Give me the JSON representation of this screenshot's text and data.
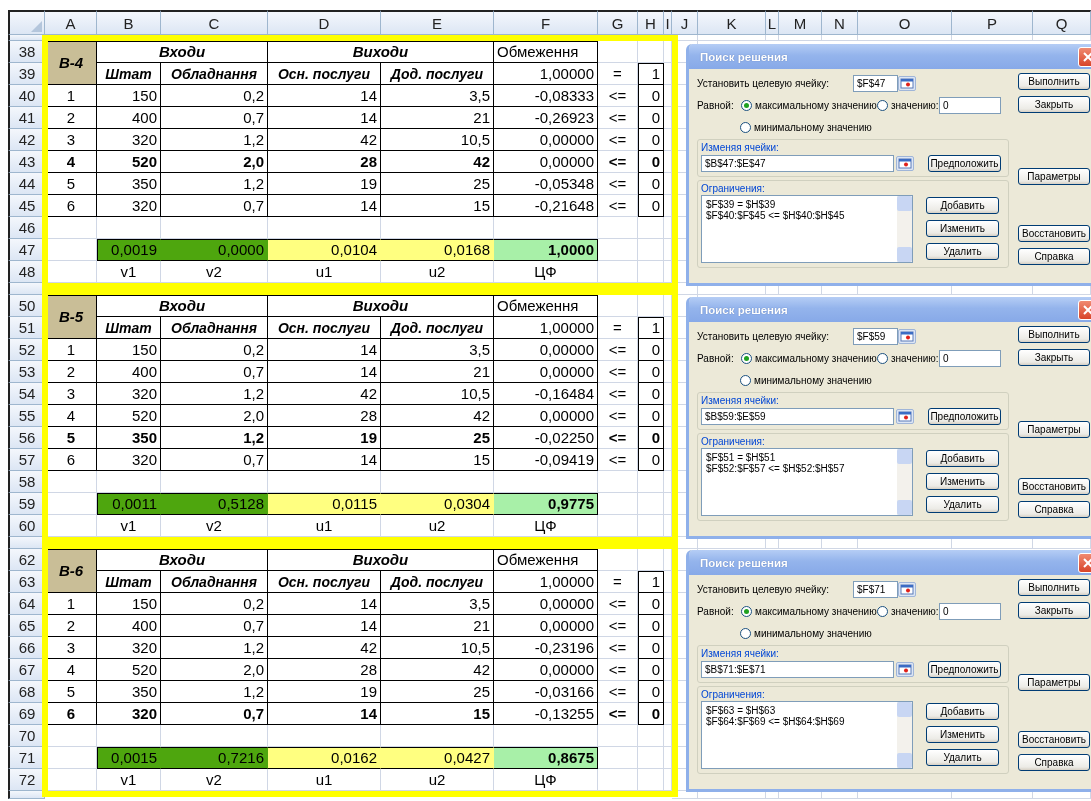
{
  "columns": [
    "A",
    "B",
    "C",
    "D",
    "E",
    "F",
    "G",
    "H",
    "I",
    "J",
    "K",
    "L",
    "M",
    "N",
    "O",
    "P",
    "Q"
  ],
  "blocks": [
    {
      "row_numbers": [
        "38",
        "39",
        "40",
        "41",
        "42",
        "43",
        "44",
        "45",
        "46",
        "47",
        "48"
      ],
      "label": "B-4",
      "groups": [
        "Входи",
        "Виходи"
      ],
      "limit_header": "Обмеження",
      "sub_headers": [
        "Штат",
        "Обладнання",
        "Осн. послуги",
        "Дод. послуги"
      ],
      "norm": {
        "value": "1,00000",
        "op": "=",
        "bound": "1"
      },
      "rows": [
        {
          "index": "1",
          "values": [
            "150",
            "0,2",
            "14",
            "3,5"
          ],
          "constraint": "-0,08333",
          "op": "<=",
          "bound": "0",
          "highlighted": false
        },
        {
          "index": "2",
          "values": [
            "400",
            "0,7",
            "14",
            "21"
          ],
          "constraint": "-0,26923",
          "op": "<=",
          "bound": "0",
          "highlighted": false
        },
        {
          "index": "3",
          "values": [
            "320",
            "1,2",
            "42",
            "10,5"
          ],
          "constraint": "0,00000",
          "op": "<=",
          "bound": "0",
          "highlighted": false
        },
        {
          "index": "4",
          "values": [
            "520",
            "2,0",
            "28",
            "42"
          ],
          "constraint": "0,00000",
          "op": "<=",
          "bound": "0",
          "highlighted": true
        },
        {
          "index": "5",
          "values": [
            "350",
            "1,2",
            "19",
            "25"
          ],
          "constraint": "-0,05348",
          "op": "<=",
          "bound": "0",
          "highlighted": false
        },
        {
          "index": "6",
          "values": [
            "320",
            "0,7",
            "14",
            "15"
          ],
          "constraint": "-0,21648",
          "op": "<=",
          "bound": "0",
          "highlighted": false
        }
      ],
      "weights": [
        {
          "value": "0,0019",
          "label": "v1",
          "color": "#4ea60e"
        },
        {
          "value": "0,0000",
          "label": "v2",
          "color": "#4ea60e"
        },
        {
          "value": "0,0104",
          "label": "u1",
          "color": "#ffff80"
        },
        {
          "value": "0,0168",
          "label": "u2",
          "color": "#ffff80"
        }
      ],
      "objective": {
        "value": "1,0000",
        "label": "ЦФ"
      }
    },
    {
      "row_numbers": [
        "50",
        "51",
        "52",
        "53",
        "54",
        "55",
        "56",
        "57",
        "58",
        "59",
        "60"
      ],
      "label": "B-5",
      "groups": [
        "Входи",
        "Виходи"
      ],
      "limit_header": "Обмеження",
      "sub_headers": [
        "Штат",
        "Обладнання",
        "Осн. послуги",
        "Дод. послуги"
      ],
      "norm": {
        "value": "1,00000",
        "op": "=",
        "bound": "1"
      },
      "rows": [
        {
          "index": "1",
          "values": [
            "150",
            "0,2",
            "14",
            "3,5"
          ],
          "constraint": "0,00000",
          "op": "<=",
          "bound": "0",
          "highlighted": false
        },
        {
          "index": "2",
          "values": [
            "400",
            "0,7",
            "14",
            "21"
          ],
          "constraint": "0,00000",
          "op": "<=",
          "bound": "0",
          "highlighted": false
        },
        {
          "index": "3",
          "values": [
            "320",
            "1,2",
            "42",
            "10,5"
          ],
          "constraint": "-0,16484",
          "op": "<=",
          "bound": "0",
          "highlighted": false
        },
        {
          "index": "4",
          "values": [
            "520",
            "2,0",
            "28",
            "42"
          ],
          "constraint": "0,00000",
          "op": "<=",
          "bound": "0",
          "highlighted": false
        },
        {
          "index": "5",
          "values": [
            "350",
            "1,2",
            "19",
            "25"
          ],
          "constraint": "-0,02250",
          "op": "<=",
          "bound": "0",
          "highlighted": true
        },
        {
          "index": "6",
          "values": [
            "320",
            "0,7",
            "14",
            "15"
          ],
          "constraint": "-0,09419",
          "op": "<=",
          "bound": "0",
          "highlighted": false
        }
      ],
      "weights": [
        {
          "value": "0,0011",
          "label": "v1",
          "color": "#4ea60e"
        },
        {
          "value": "0,5128",
          "label": "v2",
          "color": "#4ea60e"
        },
        {
          "value": "0,0115",
          "label": "u1",
          "color": "#ffff80"
        },
        {
          "value": "0,0304",
          "label": "u2",
          "color": "#ffff80"
        }
      ],
      "objective": {
        "value": "0,9775",
        "label": "ЦФ"
      }
    },
    {
      "row_numbers": [
        "62",
        "63",
        "64",
        "65",
        "66",
        "67",
        "68",
        "69",
        "70",
        "71",
        "72"
      ],
      "label": "B-6",
      "groups": [
        "Входи",
        "Виходи"
      ],
      "limit_header": "Обмеження",
      "sub_headers": [
        "Штат",
        "Обладнання",
        "Осн. послуги",
        "Дод. послуги"
      ],
      "norm": {
        "value": "1,00000",
        "op": "=",
        "bound": "1"
      },
      "rows": [
        {
          "index": "1",
          "values": [
            "150",
            "0,2",
            "14",
            "3,5"
          ],
          "constraint": "0,00000",
          "op": "<=",
          "bound": "0",
          "highlighted": false
        },
        {
          "index": "2",
          "values": [
            "400",
            "0,7",
            "14",
            "21"
          ],
          "constraint": "0,00000",
          "op": "<=",
          "bound": "0",
          "highlighted": false
        },
        {
          "index": "3",
          "values": [
            "320",
            "1,2",
            "42",
            "10,5"
          ],
          "constraint": "-0,23196",
          "op": "<=",
          "bound": "0",
          "highlighted": false
        },
        {
          "index": "4",
          "values": [
            "520",
            "2,0",
            "28",
            "42"
          ],
          "constraint": "0,00000",
          "op": "<=",
          "bound": "0",
          "highlighted": false
        },
        {
          "index": "5",
          "values": [
            "350",
            "1,2",
            "19",
            "25"
          ],
          "constraint": "-0,03166",
          "op": "<=",
          "bound": "0",
          "highlighted": false
        },
        {
          "index": "6",
          "values": [
            "320",
            "0,7",
            "14",
            "15"
          ],
          "constraint": "-0,13255",
          "op": "<=",
          "bound": "0",
          "highlighted": true
        }
      ],
      "weights": [
        {
          "value": "0,0015",
          "label": "v1",
          "color": "#4ea60e"
        },
        {
          "value": "0,7216",
          "label": "v2",
          "color": "#4ea60e"
        },
        {
          "value": "0,0162",
          "label": "u1",
          "color": "#ffff80"
        },
        {
          "value": "0,0427",
          "label": "u2",
          "color": "#ffff80"
        }
      ],
      "objective": {
        "value": "0,8675",
        "label": "ЦФ"
      }
    }
  ],
  "dialogs": [
    {
      "title": "Поиск решения",
      "target_label": "Установить целевую ячейку:",
      "target": "$F$47",
      "equal_label": "Равной:",
      "options": [
        {
          "label": "максимальному значению",
          "selected": true
        },
        {
          "label": "значению:",
          "selected": false
        },
        {
          "label": "минимальному значению",
          "selected": false
        }
      ],
      "value": "0",
      "changing_label": "Изменяя ячейки:",
      "changing": "$B$47:$E$47",
      "guess_button": "Предположить",
      "constraints_label": "Ограничения:",
      "constraints": [
        "$F$39 = $H$39",
        "$F$40:$F$45 <= $H$40:$H$45"
      ],
      "constraint_buttons": [
        "Добавить",
        "Изменить",
        "Удалить"
      ],
      "side_buttons": [
        "Выполнить",
        "Закрыть",
        "Параметры",
        "Восстановить",
        "Справка"
      ]
    },
    {
      "title": "Поиск решения",
      "target_label": "Установить целевую ячейку:",
      "target": "$F$59",
      "equal_label": "Равной:",
      "options": [
        {
          "label": "максимальному значению",
          "selected": true
        },
        {
          "label": "значению:",
          "selected": false
        },
        {
          "label": "минимальному значению",
          "selected": false
        }
      ],
      "value": "0",
      "changing_label": "Изменяя ячейки:",
      "changing": "$B$59:$E$59",
      "guess_button": "Предположить",
      "constraints_label": "Ограничения:",
      "constraints": [
        "$F$51 = $H$51",
        "$F$52:$F$57 <= $H$52:$H$57"
      ],
      "constraint_buttons": [
        "Добавить",
        "Изменить",
        "Удалить"
      ],
      "side_buttons": [
        "Выполнить",
        "Закрыть",
        "Параметры",
        "Восстановить",
        "Справка"
      ]
    },
    {
      "title": "Поиск решения",
      "target_label": "Установить целевую ячейку:",
      "target": "$F$71",
      "equal_label": "Равной:",
      "options": [
        {
          "label": "максимальному значению",
          "selected": true
        },
        {
          "label": "значению:",
          "selected": false
        },
        {
          "label": "минимальному значению",
          "selected": false
        }
      ],
      "value": "0",
      "changing_label": "Изменяя ячейки:",
      "changing": "$B$71:$E$71",
      "guess_button": "Предположить",
      "constraints_label": "Ограничения:",
      "constraints": [
        "$F$63 = $H$63",
        "$F$64:$F$69 <= $H$64:$H$69"
      ],
      "constraint_buttons": [
        "Добавить",
        "Изменить",
        "Удалить"
      ],
      "side_buttons": [
        "Выполнить",
        "Закрыть",
        "Параметры",
        "Восстановить",
        "Справка"
      ]
    }
  ]
}
